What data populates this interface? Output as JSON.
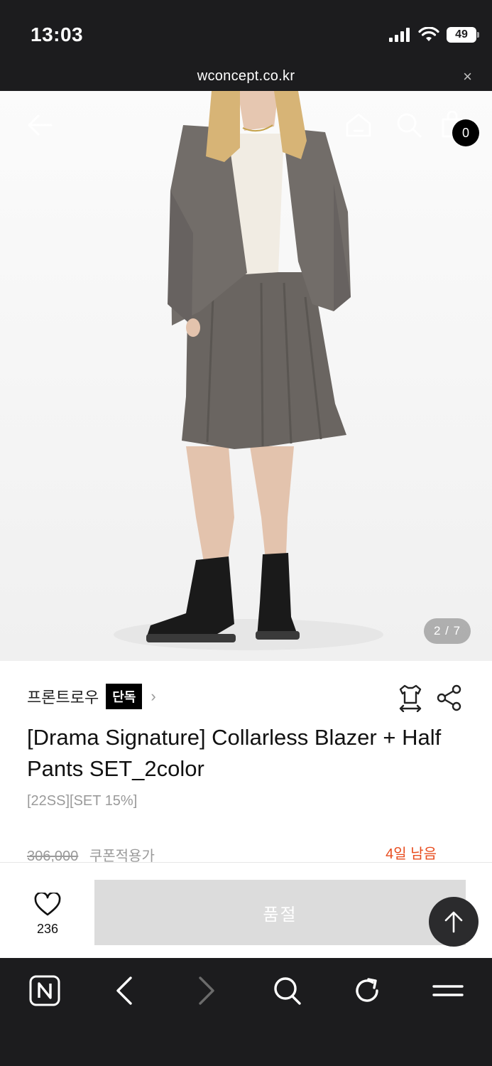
{
  "status_bar": {
    "time": "13:03",
    "battery": "49"
  },
  "url_bar": {
    "url": "wconcept.co.kr",
    "close": "×"
  },
  "hero": {
    "cart_count": "0",
    "pager": "2 / 7"
  },
  "product": {
    "brand": "프론트로우",
    "exclusive_badge": "단독",
    "chevron": "›",
    "title": "[Drama Signature] Collarless Blazer + Half Pants SET_2color",
    "tags": "[22SS][SET 15%]",
    "original_price": "306,000",
    "coupon_label": "쿠폰적용가",
    "days_left": "4일 남음"
  },
  "buy_bar": {
    "like_count": "236",
    "soldout_label": "품절"
  },
  "colors": {
    "accent": "#e84c1e",
    "dark": "#1c1c1e",
    "soldout_bg": "#dcdcdc"
  },
  "icons": [
    "back-arrow-icon",
    "home-icon",
    "search-icon",
    "shopping-bag-icon",
    "size-guide-icon",
    "share-icon",
    "heart-icon",
    "arrow-up-icon",
    "naver-n-icon",
    "chevron-left-icon",
    "chevron-right-icon",
    "reload-icon",
    "menu-icon"
  ]
}
